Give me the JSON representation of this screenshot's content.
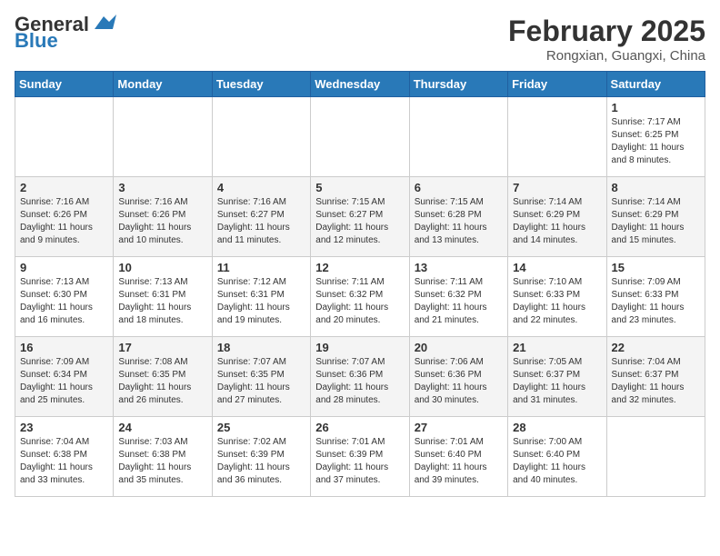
{
  "header": {
    "logo_line1": "General",
    "logo_line2": "Blue",
    "month_year": "February 2025",
    "location": "Rongxian, Guangxi, China"
  },
  "days_of_week": [
    "Sunday",
    "Monday",
    "Tuesday",
    "Wednesday",
    "Thursday",
    "Friday",
    "Saturday"
  ],
  "weeks": [
    [
      {
        "day": "",
        "info": ""
      },
      {
        "day": "",
        "info": ""
      },
      {
        "day": "",
        "info": ""
      },
      {
        "day": "",
        "info": ""
      },
      {
        "day": "",
        "info": ""
      },
      {
        "day": "",
        "info": ""
      },
      {
        "day": "1",
        "info": "Sunrise: 7:17 AM\nSunset: 6:25 PM\nDaylight: 11 hours\nand 8 minutes."
      }
    ],
    [
      {
        "day": "2",
        "info": "Sunrise: 7:16 AM\nSunset: 6:26 PM\nDaylight: 11 hours\nand 9 minutes."
      },
      {
        "day": "3",
        "info": "Sunrise: 7:16 AM\nSunset: 6:26 PM\nDaylight: 11 hours\nand 10 minutes."
      },
      {
        "day": "4",
        "info": "Sunrise: 7:16 AM\nSunset: 6:27 PM\nDaylight: 11 hours\nand 11 minutes."
      },
      {
        "day": "5",
        "info": "Sunrise: 7:15 AM\nSunset: 6:27 PM\nDaylight: 11 hours\nand 12 minutes."
      },
      {
        "day": "6",
        "info": "Sunrise: 7:15 AM\nSunset: 6:28 PM\nDaylight: 11 hours\nand 13 minutes."
      },
      {
        "day": "7",
        "info": "Sunrise: 7:14 AM\nSunset: 6:29 PM\nDaylight: 11 hours\nand 14 minutes."
      },
      {
        "day": "8",
        "info": "Sunrise: 7:14 AM\nSunset: 6:29 PM\nDaylight: 11 hours\nand 15 minutes."
      }
    ],
    [
      {
        "day": "9",
        "info": "Sunrise: 7:13 AM\nSunset: 6:30 PM\nDaylight: 11 hours\nand 16 minutes."
      },
      {
        "day": "10",
        "info": "Sunrise: 7:13 AM\nSunset: 6:31 PM\nDaylight: 11 hours\nand 18 minutes."
      },
      {
        "day": "11",
        "info": "Sunrise: 7:12 AM\nSunset: 6:31 PM\nDaylight: 11 hours\nand 19 minutes."
      },
      {
        "day": "12",
        "info": "Sunrise: 7:11 AM\nSunset: 6:32 PM\nDaylight: 11 hours\nand 20 minutes."
      },
      {
        "day": "13",
        "info": "Sunrise: 7:11 AM\nSunset: 6:32 PM\nDaylight: 11 hours\nand 21 minutes."
      },
      {
        "day": "14",
        "info": "Sunrise: 7:10 AM\nSunset: 6:33 PM\nDaylight: 11 hours\nand 22 minutes."
      },
      {
        "day": "15",
        "info": "Sunrise: 7:09 AM\nSunset: 6:33 PM\nDaylight: 11 hours\nand 23 minutes."
      }
    ],
    [
      {
        "day": "16",
        "info": "Sunrise: 7:09 AM\nSunset: 6:34 PM\nDaylight: 11 hours\nand 25 minutes."
      },
      {
        "day": "17",
        "info": "Sunrise: 7:08 AM\nSunset: 6:35 PM\nDaylight: 11 hours\nand 26 minutes."
      },
      {
        "day": "18",
        "info": "Sunrise: 7:07 AM\nSunset: 6:35 PM\nDaylight: 11 hours\nand 27 minutes."
      },
      {
        "day": "19",
        "info": "Sunrise: 7:07 AM\nSunset: 6:36 PM\nDaylight: 11 hours\nand 28 minutes."
      },
      {
        "day": "20",
        "info": "Sunrise: 7:06 AM\nSunset: 6:36 PM\nDaylight: 11 hours\nand 30 minutes."
      },
      {
        "day": "21",
        "info": "Sunrise: 7:05 AM\nSunset: 6:37 PM\nDaylight: 11 hours\nand 31 minutes."
      },
      {
        "day": "22",
        "info": "Sunrise: 7:04 AM\nSunset: 6:37 PM\nDaylight: 11 hours\nand 32 minutes."
      }
    ],
    [
      {
        "day": "23",
        "info": "Sunrise: 7:04 AM\nSunset: 6:38 PM\nDaylight: 11 hours\nand 33 minutes."
      },
      {
        "day": "24",
        "info": "Sunrise: 7:03 AM\nSunset: 6:38 PM\nDaylight: 11 hours\nand 35 minutes."
      },
      {
        "day": "25",
        "info": "Sunrise: 7:02 AM\nSunset: 6:39 PM\nDaylight: 11 hours\nand 36 minutes."
      },
      {
        "day": "26",
        "info": "Sunrise: 7:01 AM\nSunset: 6:39 PM\nDaylight: 11 hours\nand 37 minutes."
      },
      {
        "day": "27",
        "info": "Sunrise: 7:01 AM\nSunset: 6:40 PM\nDaylight: 11 hours\nand 39 minutes."
      },
      {
        "day": "28",
        "info": "Sunrise: 7:00 AM\nSunset: 6:40 PM\nDaylight: 11 hours\nand 40 minutes."
      },
      {
        "day": "",
        "info": ""
      }
    ]
  ]
}
